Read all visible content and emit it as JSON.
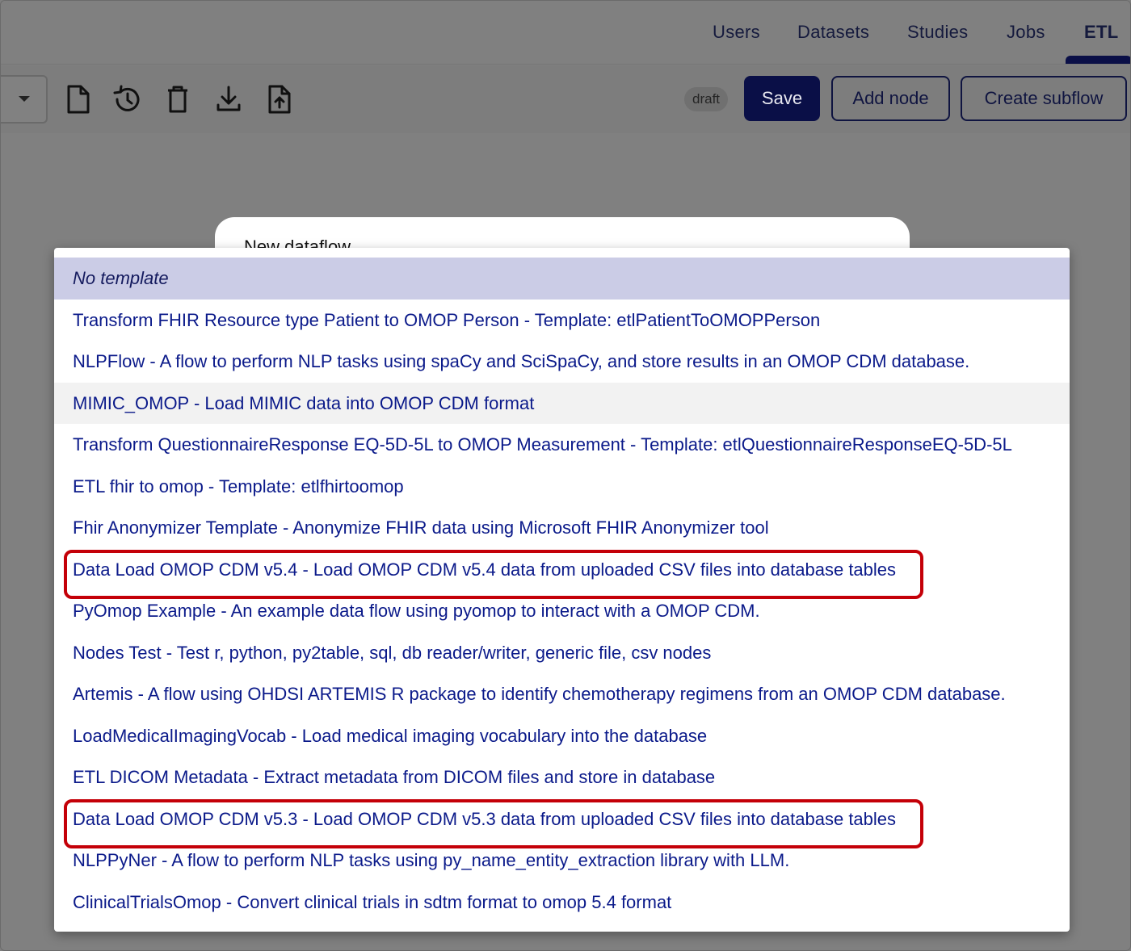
{
  "nav": {
    "tabs": [
      {
        "label": "Users"
      },
      {
        "label": "Datasets"
      },
      {
        "label": "Studies"
      },
      {
        "label": "Jobs"
      },
      {
        "label": "ETL",
        "active": true
      }
    ]
  },
  "toolbar": {
    "icons": [
      "new-file-icon",
      "history-icon",
      "trash-icon",
      "download-icon",
      "upload-file-icon"
    ],
    "status_badge": "draft",
    "save_label": "Save",
    "add_node_label": "Add node",
    "create_subflow_label": "Create subflow"
  },
  "dialog": {
    "title": "New dataflow"
  },
  "template_menu": {
    "items": [
      {
        "label": "No template",
        "state": "selected"
      },
      {
        "label": "Transform FHIR Resource type Patient to OMOP Person - Template: etlPatientToOMOPPerson"
      },
      {
        "label": "NLPFlow - A flow to perform NLP tasks using spaCy and SciSpaCy, and store results in an OMOP CDM database."
      },
      {
        "label": "MIMIC_OMOP - Load MIMIC data into OMOP CDM format",
        "state": "hovered"
      },
      {
        "label": "Transform QuestionnaireResponse EQ-5D-5L to OMOP Measurement - Template: etlQuestionnaireResponseEQ-5D-5L"
      },
      {
        "label": "ETL fhir to omop - Template: etlfhirtoomop"
      },
      {
        "label": "Fhir Anonymizer Template - Anonymize FHIR data using Microsoft FHIR Anonymizer tool"
      },
      {
        "label": "Data Load OMOP CDM v5.4 - Load OMOP CDM v5.4 data from uploaded CSV files into database tables",
        "annotated": true
      },
      {
        "label": "PyOmop Example - An example data flow using pyomop to interact with a OMOP CDM."
      },
      {
        "label": "Nodes Test - Test r, python, py2table, sql, db reader/writer, generic file, csv nodes"
      },
      {
        "label": "Artemis - A flow using OHDSI ARTEMIS R package to identify chemotherapy regimens from an OMOP CDM database."
      },
      {
        "label": "LoadMedicalImagingVocab - Load medical imaging vocabulary into the database"
      },
      {
        "label": "ETL DICOM Metadata - Extract metadata from DICOM files and store in database"
      },
      {
        "label": "Data Load OMOP CDM v5.3 - Load OMOP CDM v5.3 data from uploaded CSV files into database tables",
        "annotated": true
      },
      {
        "label": "NLPPyNer - A flow to perform NLP tasks using py_name_entity_extraction library with LLM."
      },
      {
        "label": "ClinicalTrialsOmop - Convert clinical trials in sdtm format to omop 5.4 format"
      }
    ]
  },
  "colors": {
    "primary": "#0a0f47",
    "link_text": "#0b1a8a",
    "selected_bg": "#cbcce6",
    "annotation_red": "#c40008",
    "overlay": "#808080"
  }
}
